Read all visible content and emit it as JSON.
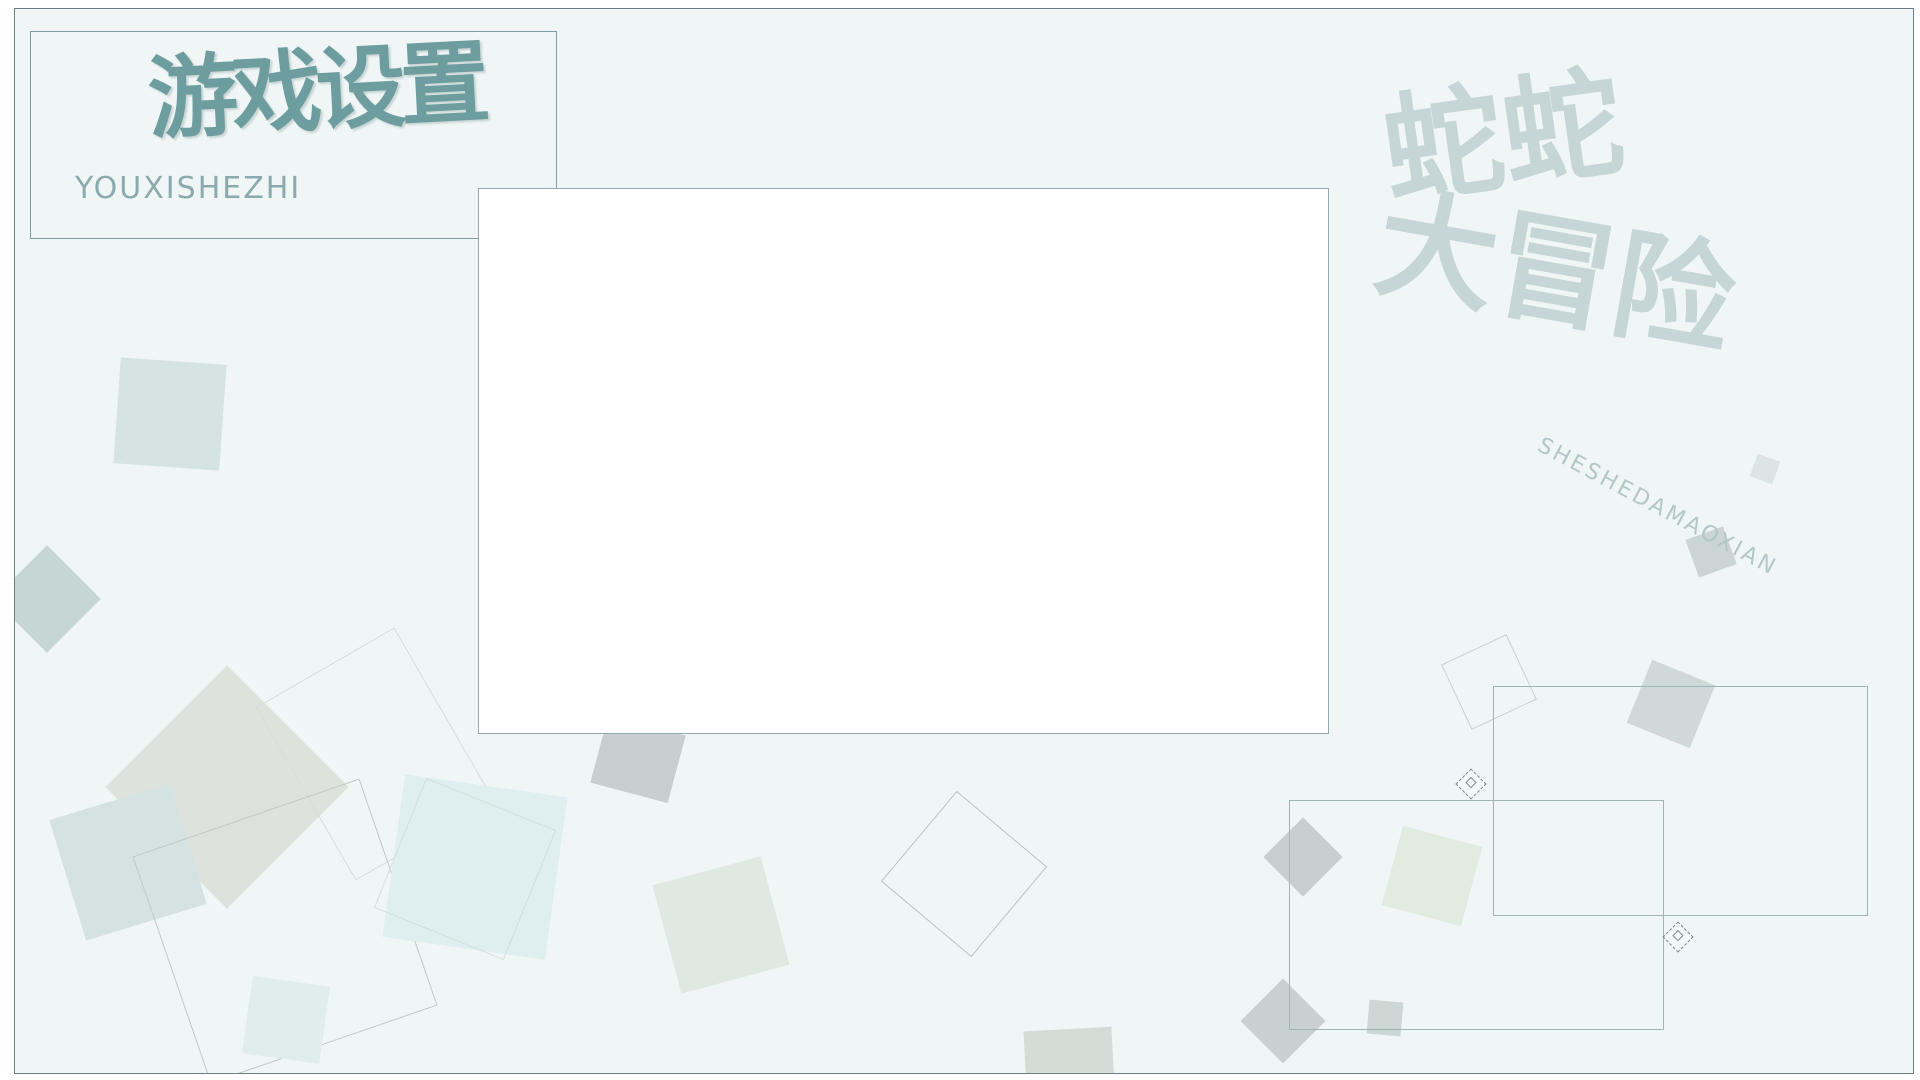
{
  "title": {
    "main": "游戏设置",
    "pinyin": "YOUXISHEZHI"
  },
  "logo": {
    "line1": "蛇蛇",
    "line2": "大冒险",
    "pinyin": "SHESHEDAMAOXIAN"
  },
  "colors": {
    "background": "#f0f6f6",
    "accent": "#6e9da0",
    "frame": "#6f7d86"
  }
}
